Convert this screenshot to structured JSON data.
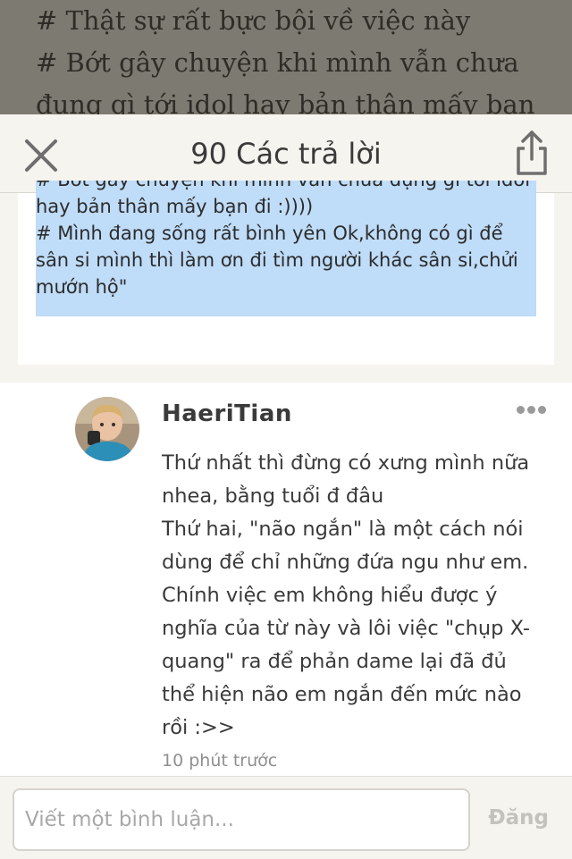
{
  "background_story": {
    "lines": [
      "# Thật sự rất bực bội về việc này",
      "# Bớt gây chuyện khi mình vẫn chưa",
      "đụng gì tới idol hay bản thân mấy bạn"
    ]
  },
  "header": {
    "title": "90 Các trả lời"
  },
  "quote": {
    "lines": [
      "# Bớt gây chuyện khi mình vẫn chưa đụng gì tới idol",
      "hay bản thân mấy bạn đi :))))",
      "# Mình đang sống rất bình yên Ok,không có gì để",
      "sân si mình thì làm ơn đi tìm người khác sân si,chửi",
      "mướn hộ\""
    ],
    "highlight_color": "#bfdcf8"
  },
  "comment": {
    "username": "HaeriTian",
    "body_lines": [
      "Thứ nhất thì đừng có xưng mình nữa",
      "nhea, bằng tuổi đ đâu",
      "Thứ hai, \"não ngắn\" là một cách nói",
      "dùng để chỉ những đứa ngu như em.",
      "Chính việc em không hiểu được ý",
      "nghĩa của từ này và lôi việc \"chụp X-",
      "quang\" ra để phản dame lại đã đủ",
      "thể hiện não em ngắn đến mức nào",
      "rồi :>>"
    ],
    "timestamp": "10 phút trước"
  },
  "composer": {
    "placeholder": "Viết một bình luận...",
    "post_label": "Đăng"
  },
  "icons": {
    "close": "close-icon",
    "share": "share-icon",
    "more": "more-options-icon"
  }
}
